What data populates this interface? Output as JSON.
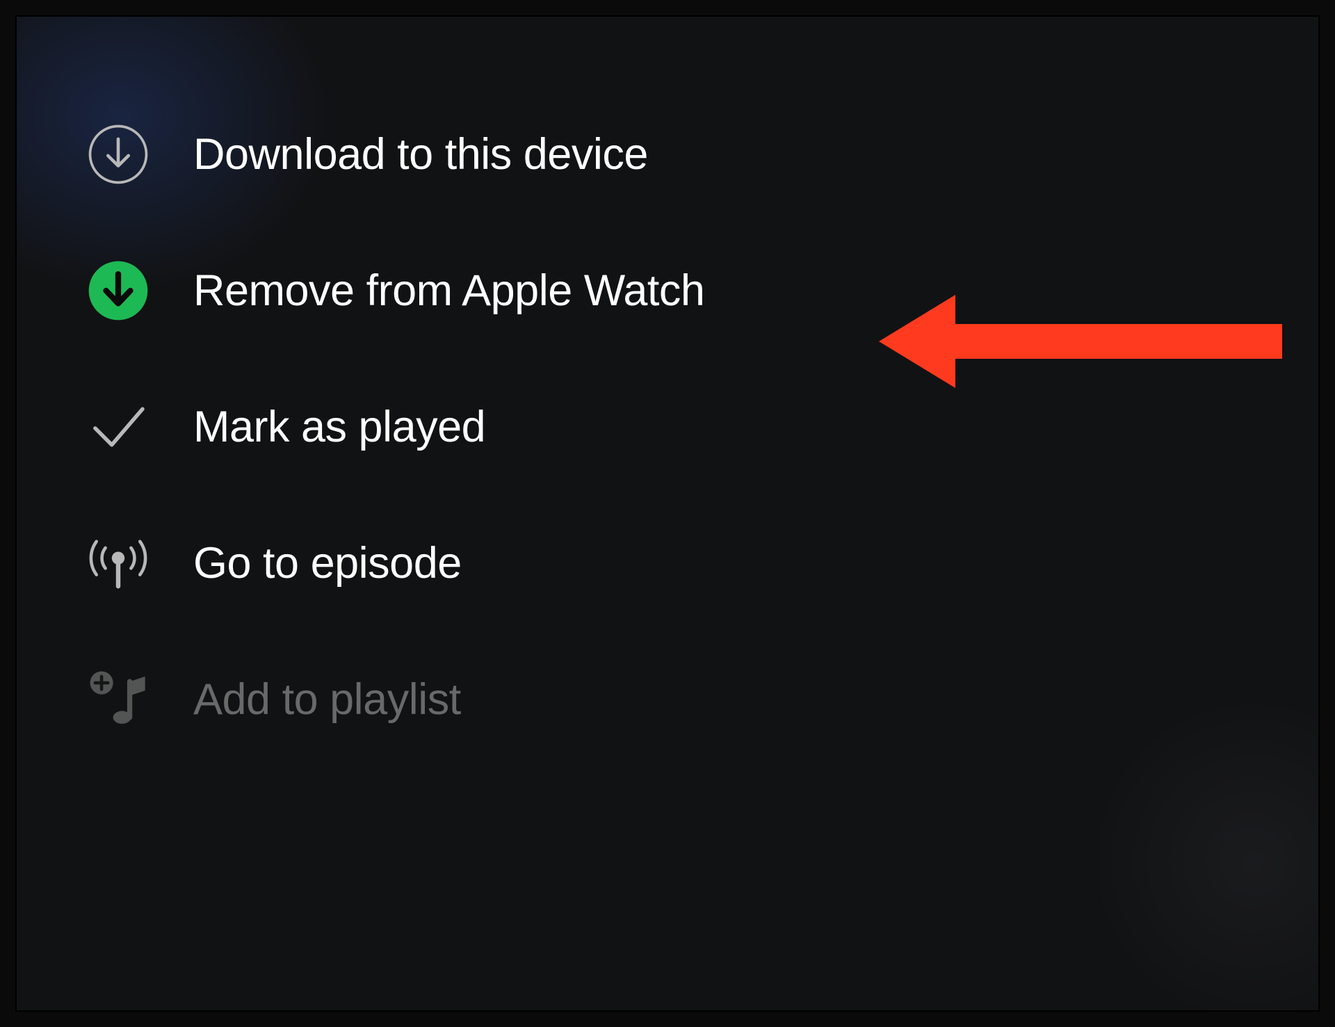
{
  "menu": {
    "items": [
      {
        "label": "Download to this device"
      },
      {
        "label": "Remove from Apple Watch"
      },
      {
        "label": "Mark as played"
      },
      {
        "label": "Go to episode"
      },
      {
        "label": "Add to playlist"
      }
    ]
  },
  "colors": {
    "accent": "#1db954",
    "annotation": "#ff3a1f"
  }
}
